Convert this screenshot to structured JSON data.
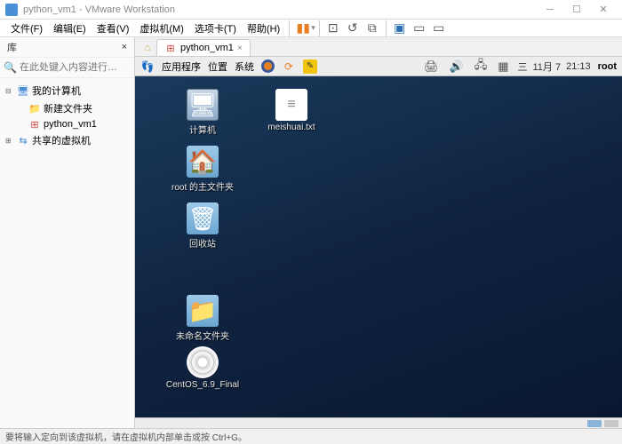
{
  "window": {
    "title": "python_vm1 - VMware Workstation"
  },
  "menubar": [
    "文件(F)",
    "编辑(E)",
    "查看(V)",
    "虚拟机(M)",
    "选项卡(T)",
    "帮助(H)"
  ],
  "sidebar": {
    "header": "库",
    "search_placeholder": "在此处键入内容进行…",
    "tree": {
      "root": "我的计算机",
      "folder": "新建文件夹",
      "vm": "python_vm1",
      "shared": "共享的虚拟机"
    }
  },
  "tab": {
    "label": "python_vm1"
  },
  "guest": {
    "menus": [
      "应用程序",
      "位置",
      "系统"
    ],
    "date_weekday": "三",
    "date_md": "11月  7",
    "time": "21:13",
    "user": "root"
  },
  "desktop": {
    "computer": "计算机",
    "txtfile": "meishuai.txt",
    "home": "root 的主文件夹",
    "trash": "回收站",
    "untitled": "未命名文件夹",
    "dvd": "CentOS_6.9_Final"
  },
  "statusbar": {
    "text": "要将输入定向到该虚拟机，请在虚拟机内部单击或按 Ctrl+G。"
  }
}
